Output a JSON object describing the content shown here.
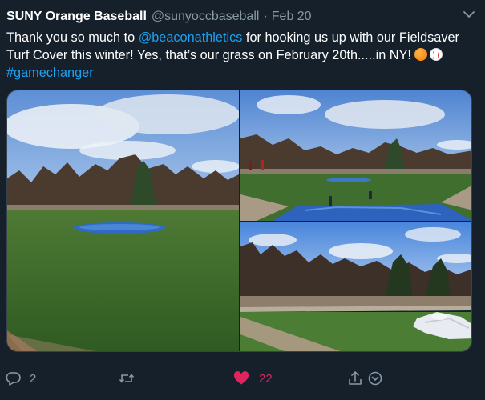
{
  "tweet": {
    "author_name": "SUNY Orange Baseball",
    "author_handle": "@sunyoccbaseball",
    "separator": "·",
    "date": "Feb 20",
    "text_part1": "Thank you so much to ",
    "mention": "@beaconathletics",
    "text_part2": " for hooking us up with our Fieldsaver Turf Cover this winter! Yes, that’s our grass on February 20th.....in NY! ",
    "hashtag": "#gamechanger",
    "emojis": [
      "orange-emoji",
      "baseball-emoji"
    ]
  },
  "actions": {
    "reply_count": "2",
    "retweet_count": "",
    "like_count": "22",
    "liked": true
  },
  "colors": {
    "background": "#15202b",
    "link": "#1da1f2",
    "secondary_text": "#8899a6",
    "like_active": "#e0245e"
  },
  "icons": [
    "chevron-down-icon",
    "reply-icon",
    "retweet-icon",
    "heart-icon",
    "share-icon",
    "bookmark-icon"
  ]
}
